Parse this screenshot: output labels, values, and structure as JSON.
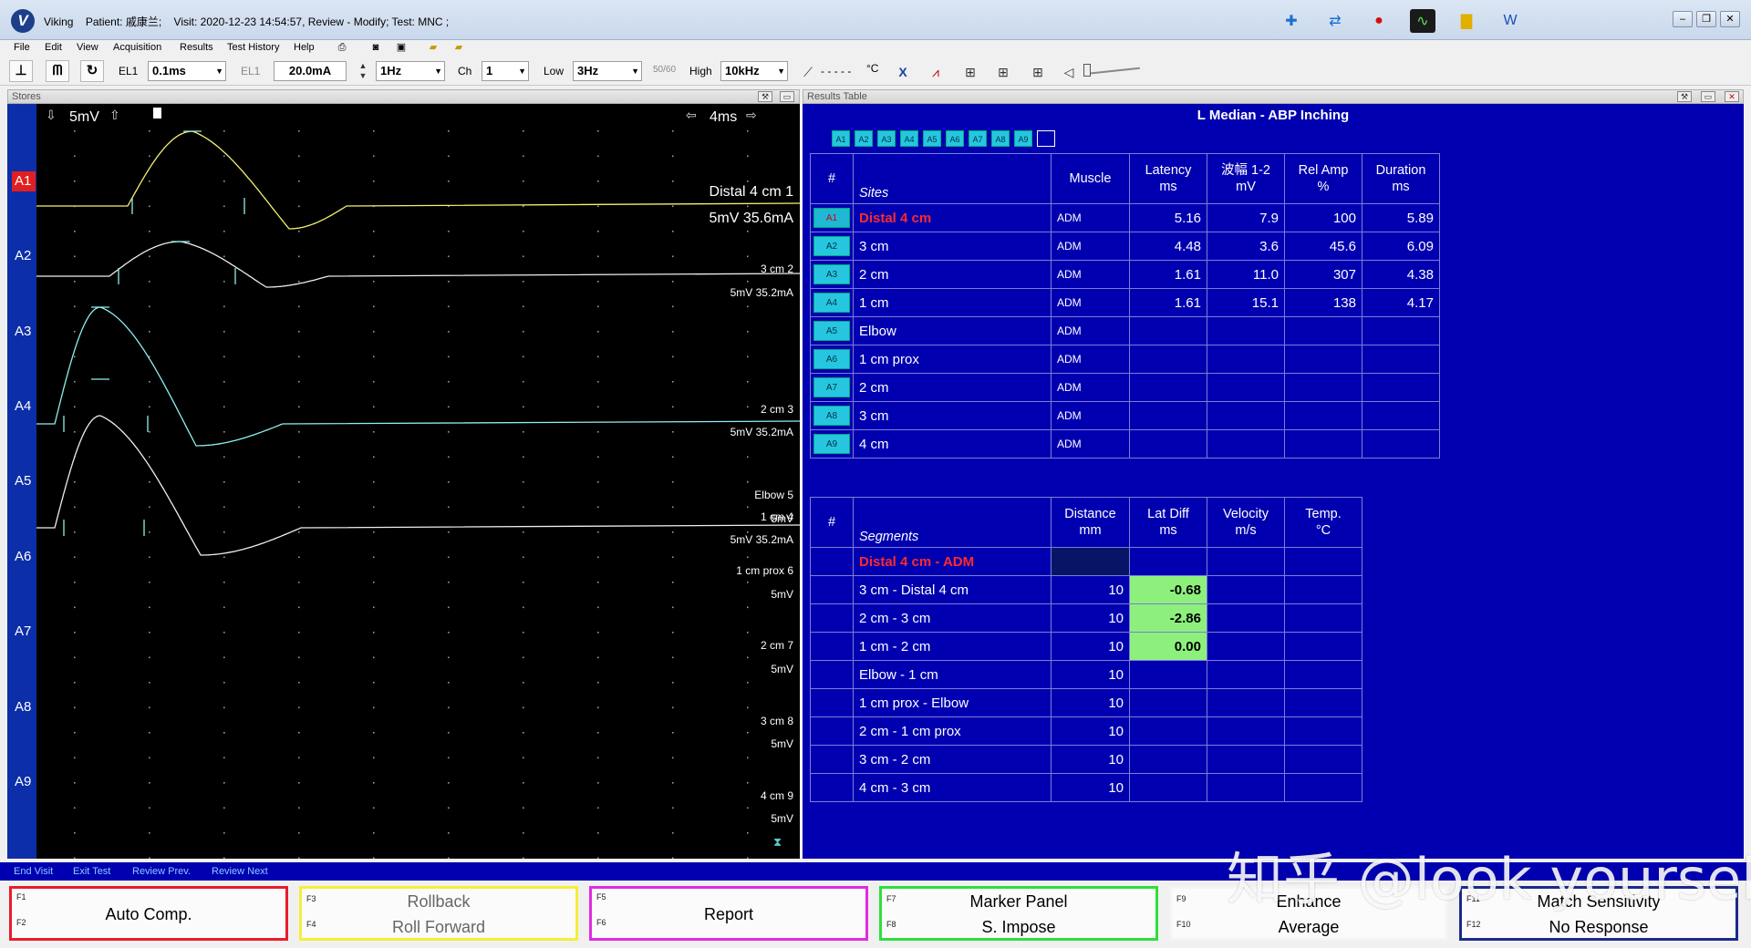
{
  "titlebar": {
    "app_name": "Viking",
    "patient": "Patient: 戚康兰;",
    "visit": "Visit: 2020-12-23 14:54:57, Review - Modify; Test: MNC ;"
  },
  "menu": {
    "items": [
      "File",
      "Edit",
      "View",
      "Acquisition",
      "Results",
      "Test History",
      "Help"
    ]
  },
  "toolbar": {
    "el1_label": "EL1",
    "timebase": "0.1ms",
    "el1_dim_label": "EL1",
    "stim_intensity": "20.0mA",
    "rate": "1Hz",
    "ch_label": "Ch",
    "ch_value": "1",
    "low_label": "Low",
    "low_value": "3Hz",
    "notch_label": "50/60",
    "high_label": "High",
    "high_value": "10kHz",
    "temp_value": "- - - - -",
    "temp_unit": "°C"
  },
  "stores": {
    "title": "Stores",
    "sensitivity": "5mV",
    "sweep": "4ms",
    "trace_labels": [
      "A1",
      "A2",
      "A3",
      "A4",
      "A5",
      "A6",
      "A7",
      "A8",
      "A9"
    ],
    "annotations": [
      {
        "name": "Distal 4 cm 1",
        "settings": "5mV 35.6mA"
      },
      {
        "name": "3 cm 2",
        "settings": "5mV 35.2mA"
      },
      {
        "name": "2 cm 3",
        "settings": "5mV 35.2mA"
      },
      {
        "name": "1 cm 4",
        "settings": "5mV 35.2mA"
      },
      {
        "name": "Elbow 5",
        "settings": "5mV"
      },
      {
        "name": "1 cm prox 6",
        "settings": "5mV"
      },
      {
        "name": "2 cm 7",
        "settings": "5mV"
      },
      {
        "name": "3 cm 8",
        "settings": "5mV"
      },
      {
        "name": "4 cm 9",
        "settings": "5mV"
      }
    ]
  },
  "results": {
    "panel_title": "Results Table",
    "table_title": "L Median - ABP Inching",
    "chips": [
      "A1",
      "A2",
      "A3",
      "A4",
      "A5",
      "A6",
      "A7",
      "A8",
      "A9"
    ],
    "sites_headers": {
      "num": "#",
      "sites": "Sites",
      "muscle": "Muscle",
      "latency": "Latency",
      "latency_unit": "ms",
      "amp": "波幅 1-2",
      "amp_unit": "mV",
      "relamp": "Rel Amp",
      "relamp_unit": "%",
      "duration": "Duration",
      "duration_unit": "ms"
    },
    "sites": [
      {
        "id": "A1",
        "site": "Distal 4 cm",
        "muscle": "ADM",
        "latency": "5.16",
        "amp": "7.9",
        "rel_amp": "100",
        "duration": "5.89"
      },
      {
        "id": "A2",
        "site": "3 cm",
        "muscle": "ADM",
        "latency": "4.48",
        "amp": "3.6",
        "rel_amp": "45.6",
        "duration": "6.09"
      },
      {
        "id": "A3",
        "site": "2 cm",
        "muscle": "ADM",
        "latency": "1.61",
        "amp": "11.0",
        "rel_amp": "307",
        "duration": "4.38"
      },
      {
        "id": "A4",
        "site": "1 cm",
        "muscle": "ADM",
        "latency": "1.61",
        "amp": "15.1",
        "rel_amp": "138",
        "duration": "4.17"
      },
      {
        "id": "A5",
        "site": "Elbow",
        "muscle": "ADM",
        "latency": "",
        "amp": "",
        "rel_amp": "",
        "duration": ""
      },
      {
        "id": "A6",
        "site": "1 cm prox",
        "muscle": "ADM",
        "latency": "",
        "amp": "",
        "rel_amp": "",
        "duration": ""
      },
      {
        "id": "A7",
        "site": "2 cm",
        "muscle": "ADM",
        "latency": "",
        "amp": "",
        "rel_amp": "",
        "duration": ""
      },
      {
        "id": "A8",
        "site": "3 cm",
        "muscle": "ADM",
        "latency": "",
        "amp": "",
        "rel_amp": "",
        "duration": ""
      },
      {
        "id": "A9",
        "site": "4 cm",
        "muscle": "ADM",
        "latency": "",
        "amp": "",
        "rel_amp": "",
        "duration": ""
      }
    ],
    "segments_headers": {
      "num": "#",
      "segments": "Segments",
      "distance": "Distance",
      "distance_unit": "mm",
      "latdiff": "Lat Diff",
      "latdiff_unit": "ms",
      "velocity": "Velocity",
      "velocity_unit": "m/s",
      "temp": "Temp.",
      "temp_unit": "°C"
    },
    "segment_first": "Distal 4 cm - ADM",
    "segments": [
      {
        "name": "3 cm - Distal 4 cm",
        "distance": "10",
        "lat_diff": "-0.68",
        "velocity": "",
        "temp": ""
      },
      {
        "name": "2 cm - 3 cm",
        "distance": "10",
        "lat_diff": "-2.86",
        "velocity": "",
        "temp": ""
      },
      {
        "name": "1 cm - 2 cm",
        "distance": "10",
        "lat_diff": "0.00",
        "velocity": "",
        "temp": ""
      },
      {
        "name": "Elbow - 1 cm",
        "distance": "10",
        "lat_diff": "",
        "velocity": "",
        "temp": ""
      },
      {
        "name": "1 cm prox - Elbow",
        "distance": "10",
        "lat_diff": "",
        "velocity": "",
        "temp": ""
      },
      {
        "name": "2 cm - 1 cm prox",
        "distance": "10",
        "lat_diff": "",
        "velocity": "",
        "temp": ""
      },
      {
        "name": "3 cm - 2 cm",
        "distance": "10",
        "lat_diff": "",
        "velocity": "",
        "temp": ""
      },
      {
        "name": "4 cm - 3 cm",
        "distance": "10",
        "lat_diff": "",
        "velocity": "",
        "temp": ""
      }
    ]
  },
  "statusbar": {
    "end_visit": "End Visit",
    "exit_test": "Exit Test",
    "review_prev": "Review Prev.",
    "review_next": "Review Next"
  },
  "fkeys": [
    {
      "top_key": "F1",
      "bottom_key": "F2",
      "label": "Auto Comp.",
      "color": "#e81c2c"
    },
    {
      "top_key": "F3",
      "bottom_key": "F4",
      "top_label": "Rollback",
      "bottom_label": "Roll Forward",
      "color": "#f5ef3a"
    },
    {
      "top_key": "F5",
      "bottom_key": "F6",
      "label": "Report",
      "color": "#e02ce0"
    },
    {
      "top_key": "F7",
      "bottom_key": "F8",
      "top_label": "Marker Panel",
      "bottom_label": "S. Impose",
      "color": "#2ee03a"
    },
    {
      "top_key": "F9",
      "bottom_key": "F10",
      "top_label": "Enhance",
      "bottom_label": "Average",
      "color": "#f4f4f4"
    },
    {
      "top_key": "F11",
      "bottom_key": "F12",
      "top_label": "Match Sensitivity",
      "bottom_label": "No Response",
      "color": "#1c2a8a"
    }
  ],
  "watermark": "知乎 @look yourself"
}
